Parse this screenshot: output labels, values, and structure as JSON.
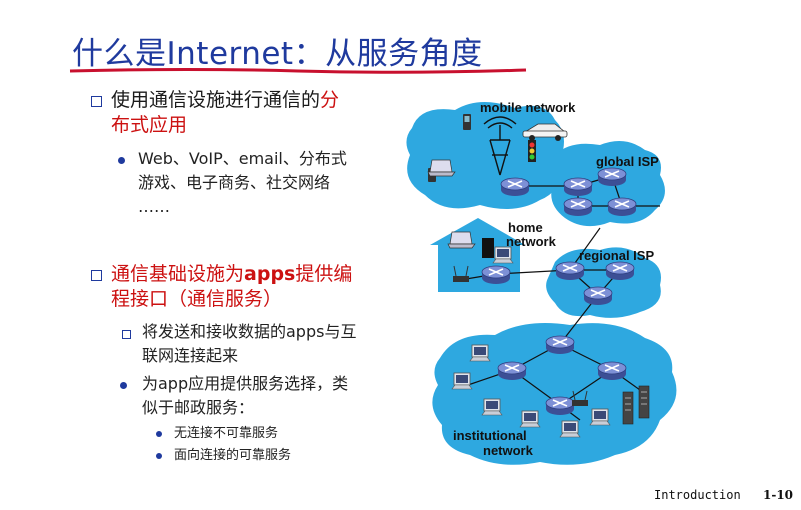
{
  "title": "什么是Internet：从服务角度",
  "bullets": [
    {
      "line1_a": "使用通信设施进行通信的",
      "line1_b": "分",
      "line2": "布式应用",
      "sub": {
        "line1": "Web、VoIP、email、分布式",
        "line2": "游戏、电子商务、社交网络",
        "line3": "……"
      }
    },
    {
      "line1_a": "通信基础设施为",
      "line1_b": "apps",
      "line1_c": "提供编",
      "line2": "程接口（通信服务）",
      "sub1": {
        "line1": "将发送和接收数据的apps与互",
        "line2": "联网连接起来"
      },
      "sub2": {
        "line1": "为app应用提供服务选择，类",
        "line2": "似于邮政服务："
      },
      "subsub": [
        "无连接不可靠服务",
        "面向连接的可靠服务"
      ]
    }
  ],
  "network": {
    "mobile": "mobile network",
    "global": "global ISP",
    "home1": "home",
    "home2": "network",
    "regional": "regional ISP",
    "inst1": "institutional",
    "inst2": "network"
  },
  "footer": {
    "left": "Introduction",
    "right": "1-10"
  },
  "colors": {
    "title": "#1f3a9e",
    "accent_red": "#cc1111",
    "cloud": "#2ea8e0",
    "router": "#5a6fb8"
  }
}
